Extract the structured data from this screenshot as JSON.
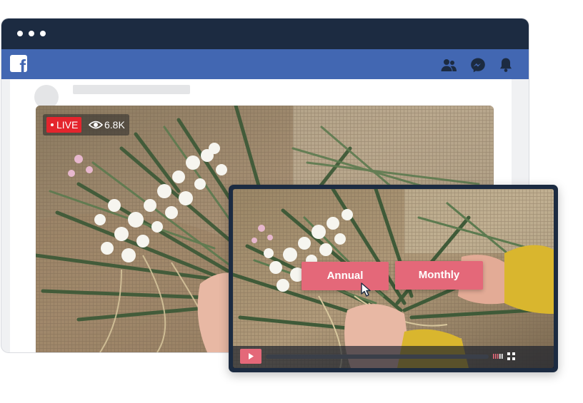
{
  "browser": {
    "brand_letter": "f",
    "nav_icons": [
      "friends-icon",
      "messenger-icon",
      "notifications-icon"
    ]
  },
  "live_stream": {
    "badge_label": "LIVE",
    "viewer_count": "6.8K",
    "viewer_icon": "eye-icon"
  },
  "player": {
    "options": [
      {
        "label": "Annual"
      },
      {
        "label": "Monthly"
      }
    ],
    "controls": {
      "play_icon": "play-icon",
      "fullscreen_icon": "fullscreen-icon"
    }
  },
  "colors": {
    "titlebar": "#1c2b41",
    "navbar": "#4267b2",
    "live_red": "#e4252d",
    "accent_pink": "#e46879"
  }
}
